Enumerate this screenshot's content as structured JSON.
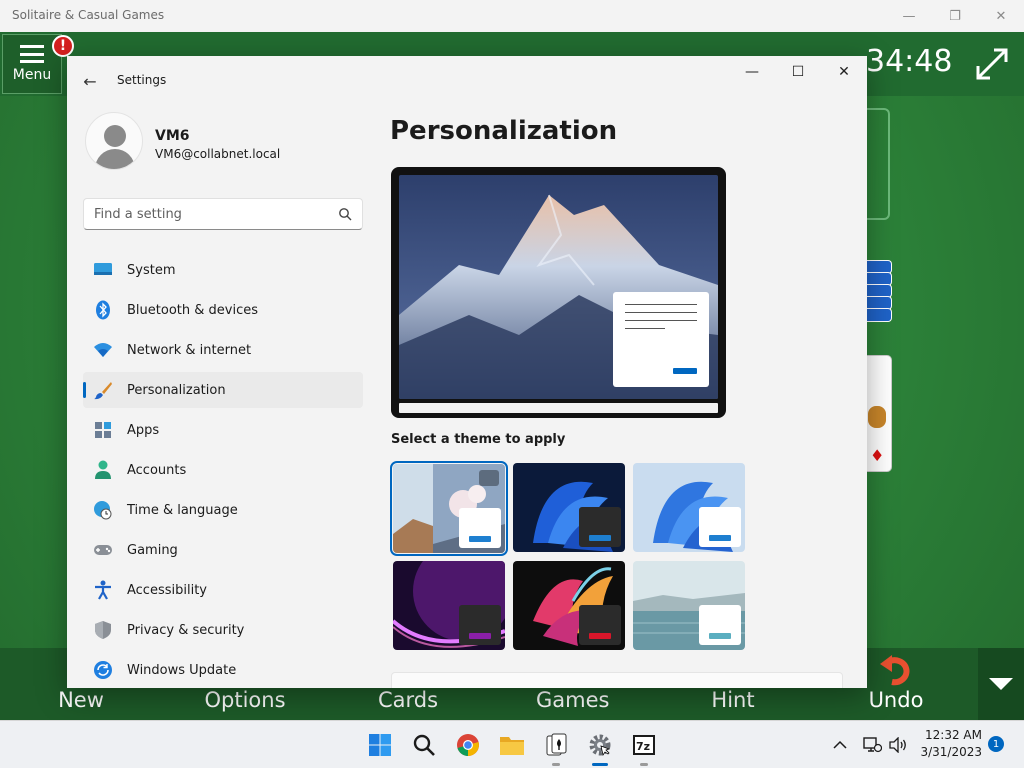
{
  "solitaire": {
    "window_title": "Solitaire & Casual Games",
    "menu_label": "Menu",
    "alert_badge": "!",
    "timer": "34:48",
    "bottom_bar": [
      "New",
      "Options",
      "Cards",
      "Games",
      "Hint",
      "Undo"
    ]
  },
  "settings": {
    "window_title": "Settings",
    "profile": {
      "name": "VM6",
      "email": "VM6@collabnet.local"
    },
    "search": {
      "placeholder": "Find a setting"
    },
    "nav": [
      {
        "label": "System",
        "icon": "system-icon"
      },
      {
        "label": "Bluetooth & devices",
        "icon": "bluetooth-icon"
      },
      {
        "label": "Network & internet",
        "icon": "wifi-icon"
      },
      {
        "label": "Personalization",
        "icon": "brush-icon",
        "active": true
      },
      {
        "label": "Apps",
        "icon": "apps-icon"
      },
      {
        "label": "Accounts",
        "icon": "person-icon"
      },
      {
        "label": "Time & language",
        "icon": "clock-globe-icon"
      },
      {
        "label": "Gaming",
        "icon": "gamepad-icon"
      },
      {
        "label": "Accessibility",
        "icon": "accessibility-icon"
      },
      {
        "label": "Privacy & security",
        "icon": "shield-icon"
      },
      {
        "label": "Windows Update",
        "icon": "update-icon"
      }
    ],
    "page_title": "Personalization",
    "themes_label": "Select a theme to apply",
    "themes": [
      {
        "name": "spotlight",
        "bar_color": "#1e7fd0",
        "selected": true
      },
      {
        "name": "dark-bloom",
        "bar_color": "#1e7fd0"
      },
      {
        "name": "light-bloom",
        "bar_color": "#1e7fd0"
      },
      {
        "name": "glow",
        "bar_color": "#8a1fa8"
      },
      {
        "name": "captured-motion",
        "bar_color": "#d8162a"
      },
      {
        "name": "flow",
        "bar_color": "#5aaec0"
      }
    ],
    "accent_color": "#0067c0"
  },
  "taskbar": {
    "time": "12:32 AM",
    "date": "3/31/2023",
    "notification_count": "1",
    "apps": [
      "start-icon",
      "search-icon",
      "chrome-icon",
      "file-explorer-icon",
      "solitaire-icon",
      "settings-icon",
      "7zip-icon"
    ]
  }
}
